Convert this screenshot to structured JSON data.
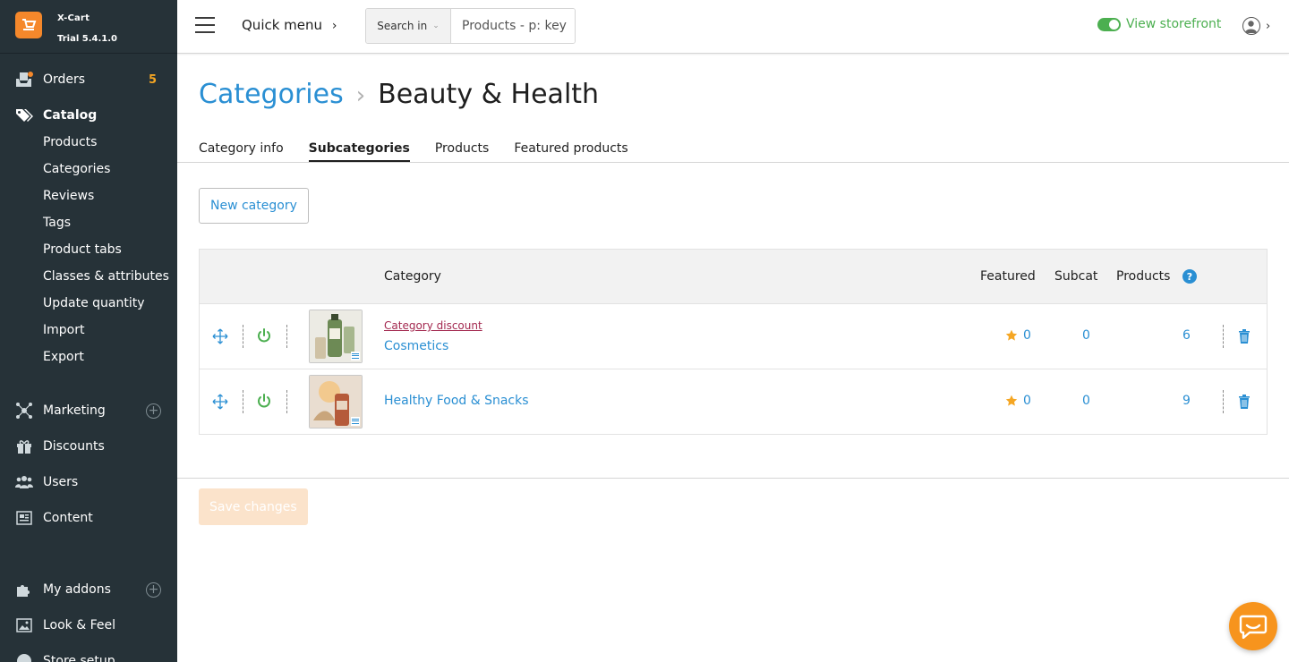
{
  "brand": {
    "name": "X-Cart",
    "version": "Trial 5.4.1.0"
  },
  "sidebar": {
    "orders": {
      "label": "Orders",
      "count": "5"
    },
    "catalog": {
      "label": "Catalog",
      "items": [
        "Products",
        "Categories",
        "Reviews",
        "Tags",
        "Product tabs",
        "Classes & attributes",
        "Update quantity",
        "Import",
        "Export"
      ]
    },
    "marketing": "Marketing",
    "discounts": "Discounts",
    "users": "Users",
    "content": "Content",
    "addons": "My addons",
    "look": "Look & Feel",
    "store_setup": "Store setup"
  },
  "header": {
    "quick_menu": "Quick menu",
    "search_in": "Search in",
    "search_placeholder": "Products - p: key",
    "storefront": "View storefront"
  },
  "page": {
    "breadcrumb_parent": "Categories",
    "title": "Beauty & Health",
    "tabs": [
      "Category info",
      "Subcategories",
      "Products",
      "Featured products"
    ],
    "active_tab": "Subcategories",
    "new_button": "New category",
    "save_button": "Save changes"
  },
  "table": {
    "headers": {
      "category": "Category",
      "featured": "Featured",
      "subcat": "Subcat",
      "products": "Products",
      "help": "?"
    },
    "rows": [
      {
        "discount": "Category discount",
        "name": "Cosmetics",
        "featured": "0",
        "subcat": "0",
        "products": "6"
      },
      {
        "discount": "",
        "name": "Healthy Food & Snacks",
        "featured": "0",
        "subcat": "0",
        "products": "9"
      }
    ]
  },
  "colors": {
    "accent": "#2a8fd3",
    "sidebar": "#263238",
    "brand": "#f5882b",
    "success": "#4caf50",
    "star": "#f5a623",
    "discount": "#a3284f"
  }
}
